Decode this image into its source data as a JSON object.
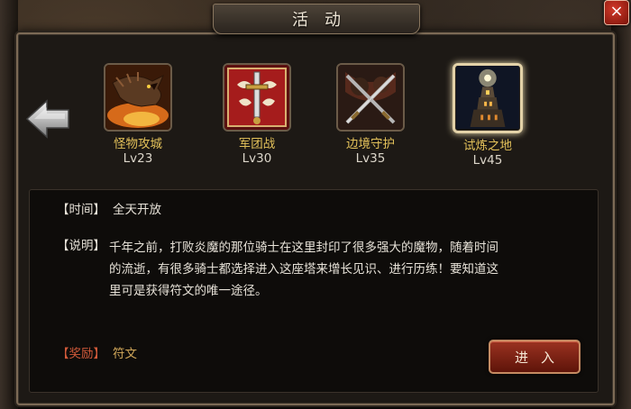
{
  "window": {
    "title": "活动"
  },
  "close_label": "×",
  "activities": [
    {
      "name": "怪物攻城",
      "level": "Lv23",
      "icon": "dragon-icon"
    },
    {
      "name": "军团战",
      "level": "Lv30",
      "icon": "sword-shield-icon"
    },
    {
      "name": "边境守护",
      "level": "Lv35",
      "icon": "crossed-swords-icon"
    },
    {
      "name": "试炼之地",
      "level": "Lv45",
      "icon": "tower-icon",
      "selected": true
    }
  ],
  "detail": {
    "time_label": "【时间】",
    "time_value": "全天开放",
    "desc_label": "【说明】",
    "desc_lines": [
      "千年之前，打败炎魔的那位骑士在这里封印了很多强大的魔物，随着时间",
      "的流逝，有很多骑士都选择进入这座塔来增长见识、进行历练！要知道这",
      "里可是获得符文的唯一途径。"
    ],
    "reward_label": "【奖励】",
    "reward_value": "符文"
  },
  "enter_label": "进入",
  "colors": {
    "accent_gold": "#e3c15a",
    "reward_red": "#d25a3a",
    "button_red": "#9b3221"
  }
}
